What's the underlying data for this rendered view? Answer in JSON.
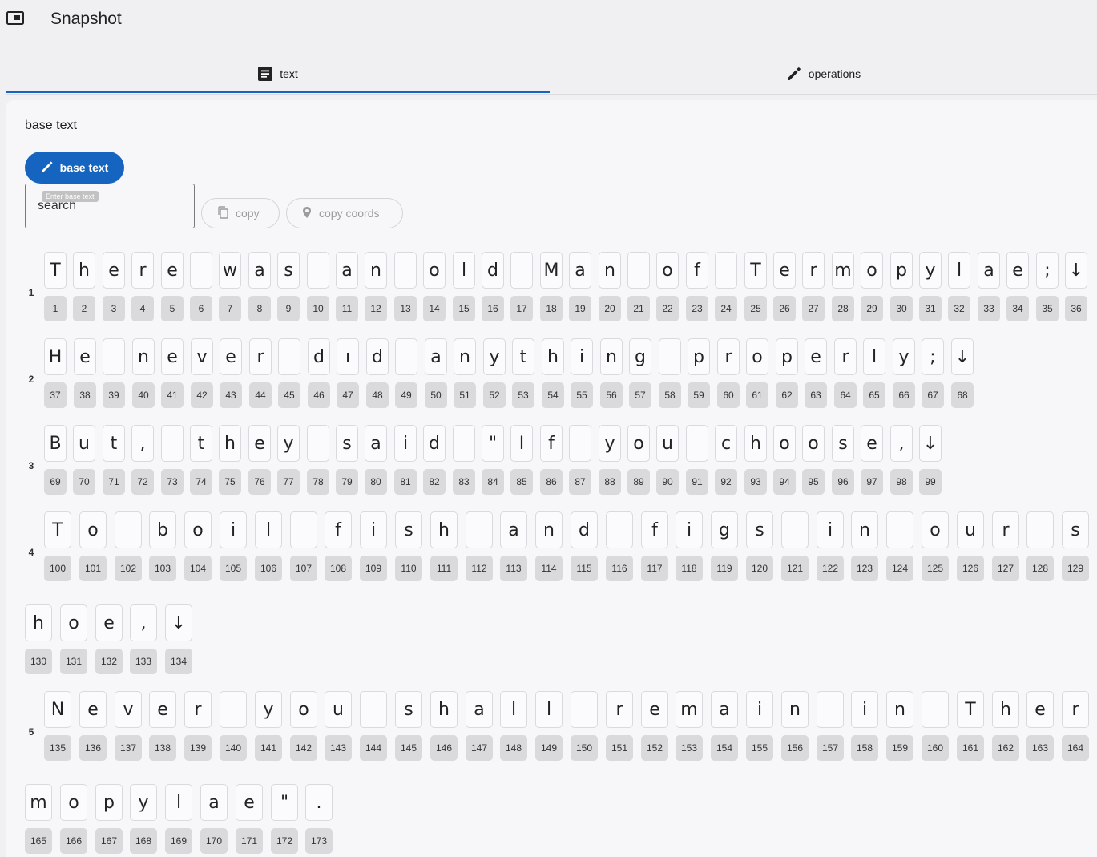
{
  "app": {
    "title": "Snapshot",
    "icon": "picture-in-picture-icon"
  },
  "tabs": [
    {
      "label": "text",
      "icon": "article-icon",
      "active": true
    },
    {
      "label": "operations",
      "icon": "pencil-icon",
      "active": false
    }
  ],
  "section": {
    "title": "base text"
  },
  "edit_button": {
    "label": "base text",
    "icon": "pencil-icon"
  },
  "search": {
    "value": "search",
    "tooltip": "Enter base text"
  },
  "copy_button": {
    "label": "copy",
    "icon": "copy-icon"
  },
  "copy_coords_button": {
    "label": "copy coords",
    "icon": "location-pin-icon"
  },
  "colors": {
    "accent": "#1565c0",
    "index_tile": "#dadadd"
  },
  "lines": [
    {
      "number": "1",
      "chars": [
        "T",
        "h",
        "e",
        "r",
        "e",
        " ",
        "w",
        "a",
        "s",
        " ",
        "a",
        "n",
        " ",
        "o",
        "l",
        "d",
        " ",
        "M",
        "a",
        "n",
        " ",
        "o",
        "f",
        " ",
        "T",
        "e",
        "r",
        "m",
        "o",
        "p",
        "y",
        "l",
        "a",
        "e",
        ";",
        "↓"
      ]
    },
    {
      "number": "2",
      "chars": [
        "H",
        "e",
        " ",
        "n",
        "e",
        "v",
        "e",
        "r",
        " ",
        "d",
        "ı",
        "d",
        " ",
        "a",
        "n",
        "y",
        "t",
        "h",
        "i",
        "n",
        "g",
        " ",
        "p",
        "r",
        "o",
        "p",
        "e",
        "r",
        "l",
        "y",
        ";",
        "↓"
      ]
    },
    {
      "number": "3",
      "chars": [
        "B",
        "u",
        "t",
        ",",
        " ",
        "t",
        "h",
        "e",
        "y",
        " ",
        "s",
        "a",
        "i",
        "d",
        " ",
        "\"",
        "I",
        "f",
        " ",
        "y",
        "o",
        "u",
        " ",
        "c",
        "h",
        "o",
        "o",
        "s",
        "e",
        ",",
        "↓"
      ]
    },
    {
      "number": "4",
      "chars": [
        "T",
        "o",
        " ",
        "b",
        "o",
        "i",
        "l",
        " ",
        "f",
        "i",
        "s",
        "h",
        " ",
        "a",
        "n",
        "d",
        " ",
        "f",
        "i",
        "g",
        "s",
        " ",
        "i",
        "n",
        " ",
        "o",
        "u",
        "r",
        " ",
        "s",
        "h",
        "o",
        "e",
        ",",
        "↓"
      ]
    },
    {
      "number": "5",
      "chars": [
        "N",
        "e",
        "v",
        "e",
        "r",
        " ",
        "y",
        "o",
        "u",
        " ",
        "s",
        "h",
        "a",
        "l",
        "l",
        " ",
        "r",
        "e",
        "m",
        "a",
        "i",
        "n",
        " ",
        "i",
        "n",
        " ",
        "T",
        "h",
        "e",
        "r",
        "m",
        "o",
        "p",
        "y",
        "l",
        "a",
        "e",
        "\"",
        "."
      ]
    }
  ]
}
